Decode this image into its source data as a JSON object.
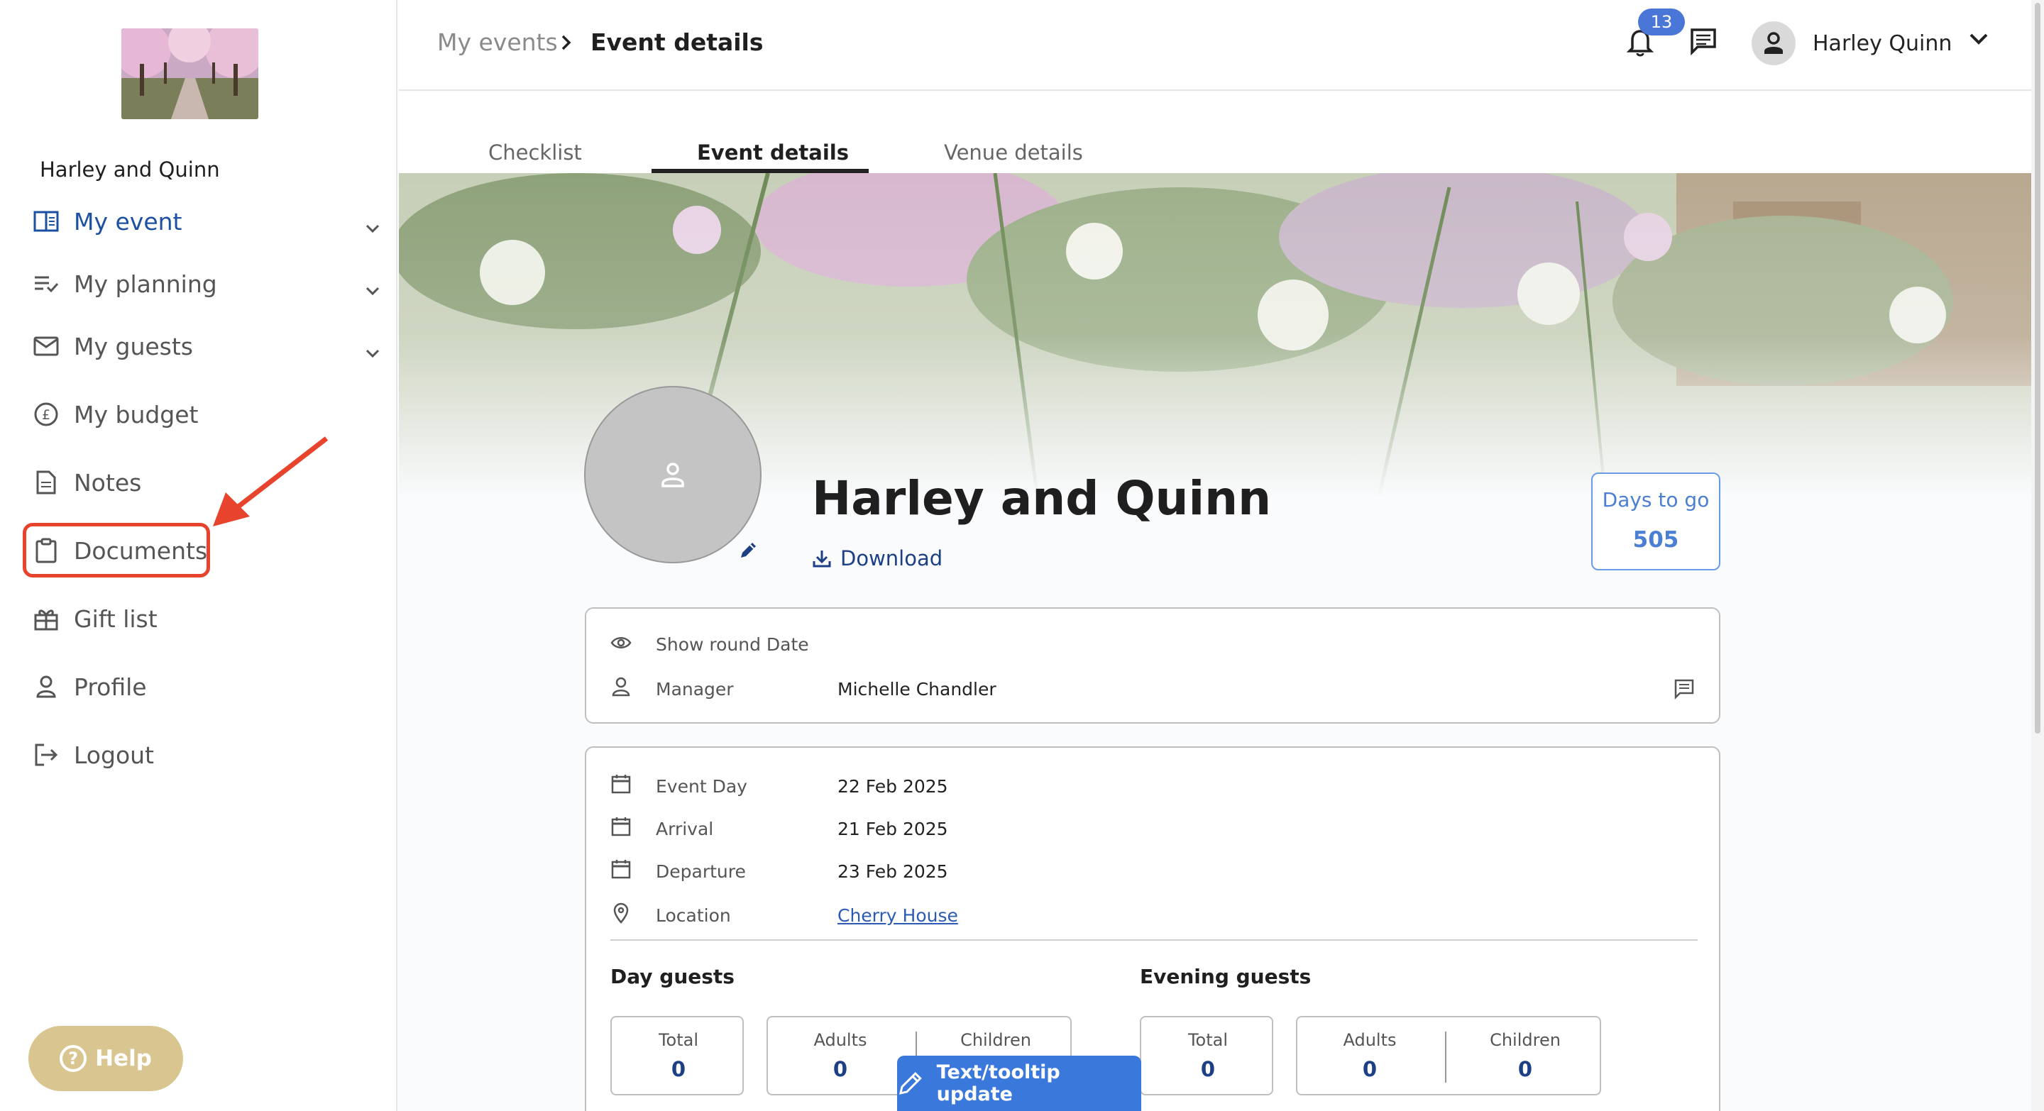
{
  "sidebar": {
    "event_name": "Harley and Quinn",
    "items": [
      {
        "label": "My event",
        "icon": "book-open-icon",
        "active": true
      },
      {
        "label": "My planning",
        "icon": "checklist-icon"
      },
      {
        "label": "My guests",
        "icon": "mail-icon"
      },
      {
        "label": "My budget",
        "icon": "pound-coin-icon"
      },
      {
        "label": "Notes",
        "icon": "document-icon"
      },
      {
        "label": "Documents",
        "icon": "clipboard-icon"
      },
      {
        "label": "Gift list",
        "icon": "gift-icon"
      },
      {
        "label": "Profile",
        "icon": "person-icon"
      },
      {
        "label": "Logout",
        "icon": "logout-icon"
      }
    ],
    "help_label": "Help"
  },
  "header": {
    "breadcrumb": [
      "My events",
      "Event details"
    ],
    "notification_count": "13",
    "user_name": "Harley Quinn"
  },
  "tabs": [
    "Checklist",
    "Event details",
    "Venue details"
  ],
  "active_tab": "Event details",
  "event": {
    "title": "Harley and Quinn",
    "download_label": "Download",
    "days_label": "Days to go",
    "days_value": "505"
  },
  "info_card": {
    "show_round_date": "Show round Date",
    "manager_label": "Manager",
    "manager_value": "Michelle Chandler"
  },
  "details_card": {
    "rows": [
      {
        "label": "Event Day",
        "value": "22 Feb 2025"
      },
      {
        "label": "Arrival",
        "value": "21 Feb 2025"
      },
      {
        "label": "Departure",
        "value": "23 Feb 2025"
      },
      {
        "label": "Location",
        "value": "Cherry House"
      }
    ],
    "day_guests": {
      "title": "Day guests",
      "total_label": "Total",
      "total": "0",
      "adults_label": "Adults",
      "adults": "0",
      "children_label": "Children",
      "children": ""
    },
    "evening_guests": {
      "title": "Evening guests",
      "total_label": "Total",
      "total": "0",
      "adults_label": "Adults",
      "adults": "0",
      "children_label": "Children",
      "children": "0"
    }
  },
  "toast": {
    "label": "Text/tooltip update"
  },
  "colors": {
    "accent": "#1d4fa2",
    "annotation": "#e8432c",
    "help": "#d9c58f",
    "toast": "#3b78dc"
  }
}
